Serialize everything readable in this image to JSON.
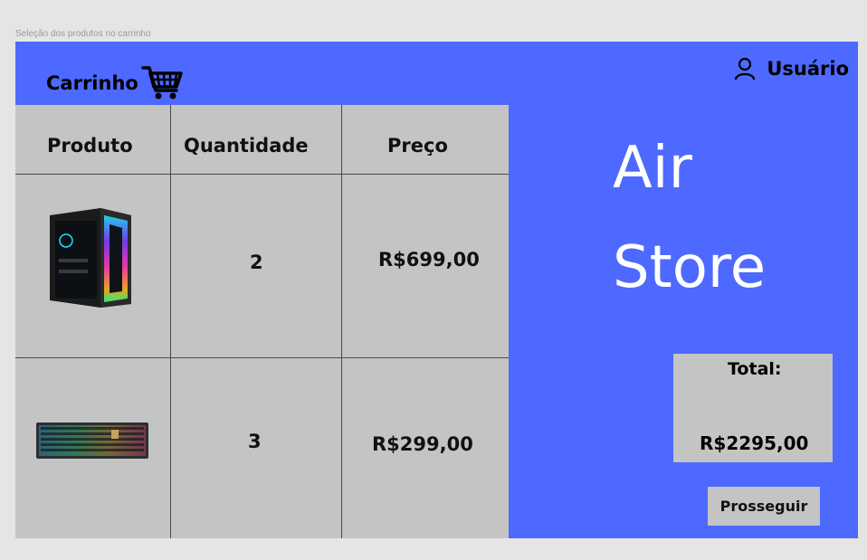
{
  "frame": {
    "label": "Seleção dos produtos no carrinho"
  },
  "header": {
    "cart_title": "Carrinho",
    "user_label": "Usuário"
  },
  "table": {
    "headers": [
      "Produto",
      "Quantidade",
      "Preço"
    ],
    "rows": [
      {
        "product": "pc-case",
        "quantity": "2",
        "price": "R$699,00"
      },
      {
        "product": "rgb-keyboard",
        "quantity": "3",
        "price": "R$299,00"
      }
    ]
  },
  "brand": {
    "line1": "Air",
    "line2": "Store"
  },
  "summary": {
    "total_label": "Total:",
    "total_value": "R$2295,00",
    "proceed_label": "Prosseguir"
  },
  "colors": {
    "accent": "#4d69ff",
    "panel": "#c4c4c4"
  },
  "icons": {
    "cart": "shopping-cart-icon",
    "user": "user-icon"
  }
}
